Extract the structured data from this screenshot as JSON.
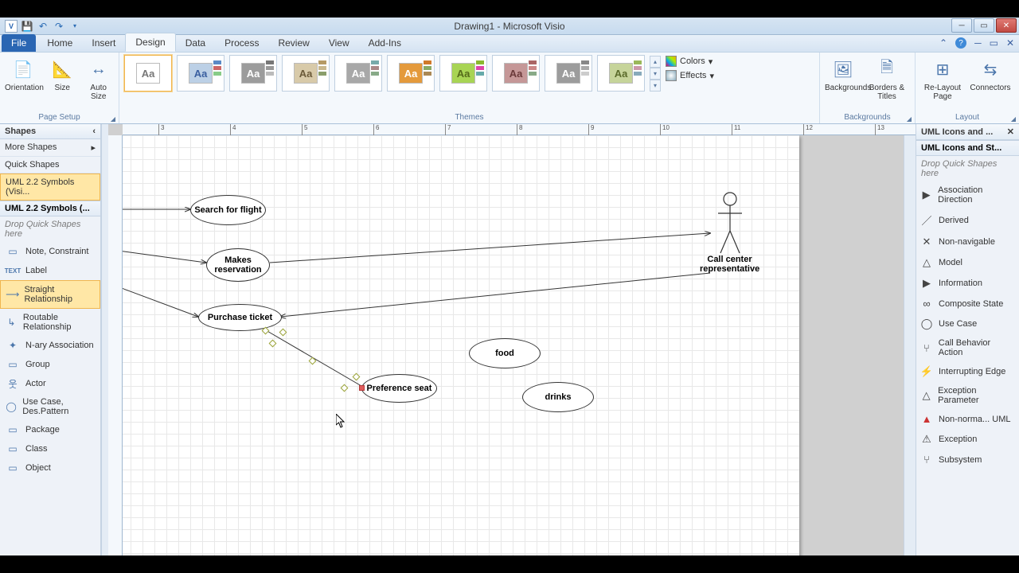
{
  "title": "Drawing1 - Microsoft Visio",
  "tabs": {
    "file": "File",
    "home": "Home",
    "insert": "Insert",
    "design": "Design",
    "data": "Data",
    "process": "Process",
    "review": "Review",
    "view": "View",
    "addins": "Add-Ins"
  },
  "ribbon": {
    "page_setup": {
      "label": "Page Setup",
      "orientation": "Orientation",
      "size": "Size",
      "autosize": "Auto Size"
    },
    "themes": {
      "label": "Themes",
      "colors_label": "Colors",
      "effects_label": "Effects"
    },
    "backgrounds": {
      "label": "Backgrounds",
      "backgrounds": "Backgrounds",
      "borders": "Borders & Titles"
    },
    "layout": {
      "label": "Layout",
      "relayout": "Re-Layout Page",
      "connectors": "Connectors"
    }
  },
  "left": {
    "shapes": "Shapes",
    "more": "More Shapes",
    "quick": "Quick Shapes",
    "stencil": "UML 2.2 Symbols (Visi...",
    "stencil2": "UML 2.2 Symbols (...",
    "drop": "Drop Quick Shapes here",
    "items": [
      {
        "l": "Note, Constraint"
      },
      {
        "l": "Label"
      },
      {
        "l": "Straight Relationship",
        "sel": true
      },
      {
        "l": "Routable Relationship"
      },
      {
        "l": "N-ary Association"
      },
      {
        "l": "Group"
      },
      {
        "l": "Actor"
      },
      {
        "l": "Use Case, Des.Pattern"
      },
      {
        "l": "Package"
      },
      {
        "l": "Class"
      },
      {
        "l": "Object"
      }
    ]
  },
  "right": {
    "tab": "UML Icons and ...",
    "title": "UML Icons and St...",
    "drop": "Drop Quick Shapes here",
    "items": [
      "Association Direction",
      "Derived",
      "Non-navigable",
      "Model",
      "Information",
      "Composite State",
      "Use Case",
      "Call Behavior Action",
      "Interrupting Edge",
      "Exception Parameter",
      "Non-norma... UML",
      "Exception",
      "Subsystem"
    ]
  },
  "diagram": {
    "use_cases": {
      "search": "Search for flight",
      "reserve": "Makes reservation",
      "purchase": "Purchase ticket",
      "pref": "Preference seat",
      "food": "food",
      "drinks": "drinks"
    },
    "actor": "Call center representative"
  },
  "ruler_labels": [
    "3",
    "4",
    "5",
    "6",
    "7",
    "8",
    "9",
    "10",
    "11",
    "12",
    "13"
  ]
}
